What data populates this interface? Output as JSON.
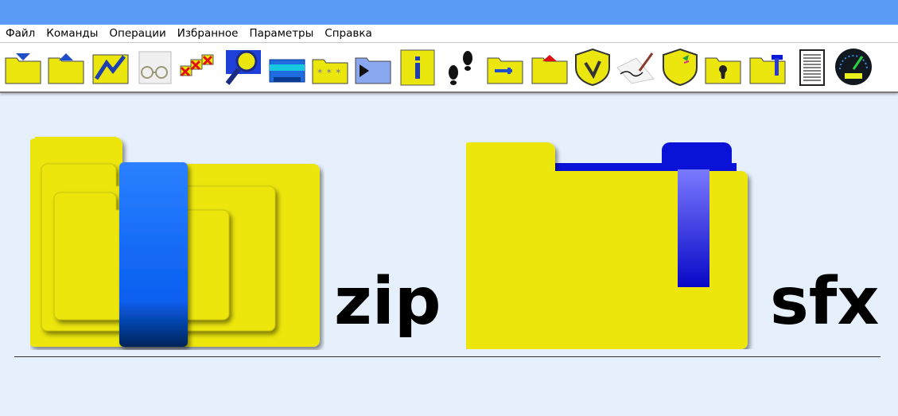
{
  "menu": {
    "items": [
      "Файл",
      "Команды",
      "Операции",
      "Избранное",
      "Параметры",
      "Справка"
    ]
  },
  "toolbar": {
    "buttons": [
      "add-to-archive-icon",
      "extract-icon",
      "test-icon",
      "view-icon",
      "delete-icon",
      "find-icon",
      "wizard-icon",
      "info-icon-stars",
      "folder-arrow-icon",
      "info-icon",
      "footprints-icon",
      "repair-folder-icon",
      "folder-up-icon",
      "virus-scan-icon",
      "comment-icon",
      "protect-icon",
      "lock-icon",
      "sfx-icon",
      "report-icon",
      "benchmark-icon"
    ]
  },
  "main": {
    "zip_label": "zip",
    "sfx_label": "sfx"
  },
  "colors": {
    "titlebar": "#5b9bf8",
    "folder_yellow": "#ece60f",
    "strap_blue": "#0a5ff0",
    "background": "#e6f0fc"
  }
}
